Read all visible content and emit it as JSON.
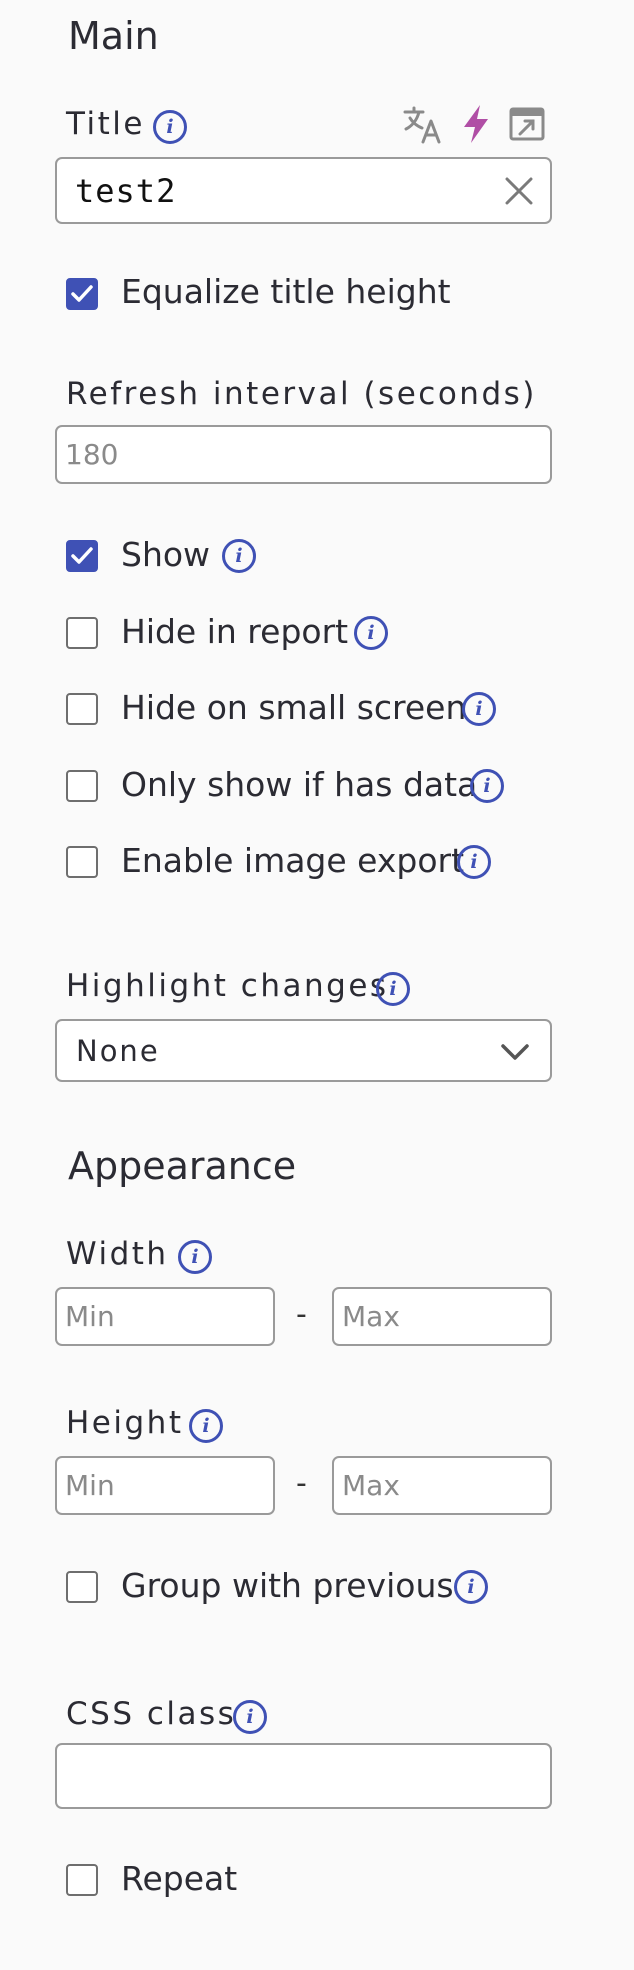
{
  "main": {
    "heading": "Main",
    "title_field": {
      "label": "Title",
      "value": "test2"
    },
    "equalize_title_height": {
      "label": "Equalize title height",
      "checked": true
    },
    "refresh_interval": {
      "label": "Refresh interval (seconds)",
      "placeholder": "180"
    },
    "checkboxes": [
      {
        "label": "Show",
        "checked": true
      },
      {
        "label": "Hide in report",
        "checked": false
      },
      {
        "label": "Hide on small screen",
        "checked": false
      },
      {
        "label": "Only show if has data",
        "checked": false
      },
      {
        "label": "Enable image export",
        "checked": false
      }
    ],
    "highlight_changes": {
      "label": "Highlight changes",
      "selected": "None"
    }
  },
  "appearance": {
    "heading": "Appearance",
    "width": {
      "label": "Width",
      "min_placeholder": "Min",
      "max_placeholder": "Max",
      "separator": "-"
    },
    "height": {
      "label": "Height",
      "min_placeholder": "Min",
      "max_placeholder": "Max",
      "separator": "-"
    },
    "group_with_previous": {
      "label": "Group with previous",
      "checked": false
    },
    "css_class": {
      "label": "CSS class",
      "value": ""
    },
    "repeat": {
      "label": "Repeat",
      "checked": false
    }
  },
  "icons": {
    "info": "info-icon",
    "translate": "translate-icon",
    "lightning": "lightning-icon",
    "open_external": "open-external-icon",
    "clear": "close-icon",
    "dropdown": "chevron-down-icon",
    "check": "checkmark-icon"
  },
  "colors": {
    "accent": "#3f51b5",
    "lightning": "#b04ea5",
    "icon_gray": "#8a8a8a"
  },
  "info_glyph": "i"
}
